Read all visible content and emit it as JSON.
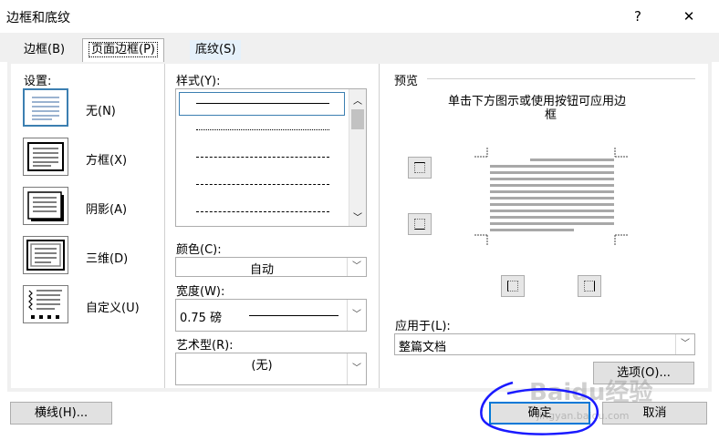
{
  "window": {
    "title": "边框和底纹",
    "help_label": "?",
    "close_label": "✕"
  },
  "tabs": [
    {
      "label": "边框(B)"
    },
    {
      "label": "页面边框(P)"
    },
    {
      "label": "底纹(S)"
    }
  ],
  "settings": {
    "label": "设置:",
    "items": [
      {
        "label": "无(N)"
      },
      {
        "label": "方框(X)"
      },
      {
        "label": "阴影(A)"
      },
      {
        "label": "三维(D)"
      },
      {
        "label": "自定义(U)"
      }
    ]
  },
  "style": {
    "label": "样式(Y):"
  },
  "color": {
    "label": "颜色(C):",
    "value": "自动"
  },
  "width": {
    "label": "宽度(W):",
    "value": "0.75 磅"
  },
  "art": {
    "label": "艺术型(R):",
    "value": "(无)"
  },
  "preview": {
    "label": "预览",
    "hint_line1": "单击下方图示或使用按钮可应用边",
    "hint_line2": "框"
  },
  "apply_to": {
    "label": "应用于(L):",
    "value": "整篇文档"
  },
  "buttons": {
    "options": "选项(O)...",
    "horizontal_line": "横线(H)...",
    "ok": "确定",
    "cancel": "取消"
  },
  "watermark": {
    "text": "Baidu经验",
    "url": "jingyan.baidu.com"
  },
  "colors": {
    "accent": "#0078d7",
    "annotation": "#1a1aff"
  }
}
